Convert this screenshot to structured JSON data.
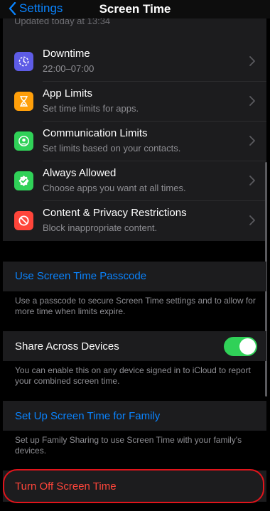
{
  "nav": {
    "back_label": "Settings",
    "title": "Screen Time"
  },
  "peek_text": "Updated today at 13:34",
  "options": [
    {
      "title": "Downtime",
      "subtitle": "22:00–07:00",
      "icon": "moon-clock-icon",
      "color": "#5e5ce6"
    },
    {
      "title": "App Limits",
      "subtitle": "Set time limits for apps.",
      "icon": "hourglass-icon",
      "color": "#ff9f0a"
    },
    {
      "title": "Communication Limits",
      "subtitle": "Set limits based on your contacts.",
      "icon": "person-circle-icon",
      "color": "#30d158"
    },
    {
      "title": "Always Allowed",
      "subtitle": "Choose apps you want at all times.",
      "icon": "checkmark-badge-icon",
      "color": "#30d158"
    },
    {
      "title": "Content & Privacy Restrictions",
      "subtitle": "Block inappropriate content.",
      "icon": "no-entry-icon",
      "color": "#ff453a"
    }
  ],
  "passcode": {
    "label": "Use Screen Time Passcode",
    "footer": "Use a passcode to secure Screen Time settings and to allow for more time when limits expire."
  },
  "share": {
    "label": "Share Across Devices",
    "enabled": true,
    "footer": "You can enable this on any device signed in to iCloud to report your combined screen time."
  },
  "family": {
    "label": "Set Up Screen Time for Family",
    "footer": "Set up Family Sharing to use Screen Time with your family's devices."
  },
  "turn_off": {
    "label": "Turn Off Screen Time"
  },
  "colors": {
    "accent": "#0a84ff",
    "destructive": "#ff453a",
    "toggle_on": "#30d158",
    "annotation": "#e1141b"
  }
}
